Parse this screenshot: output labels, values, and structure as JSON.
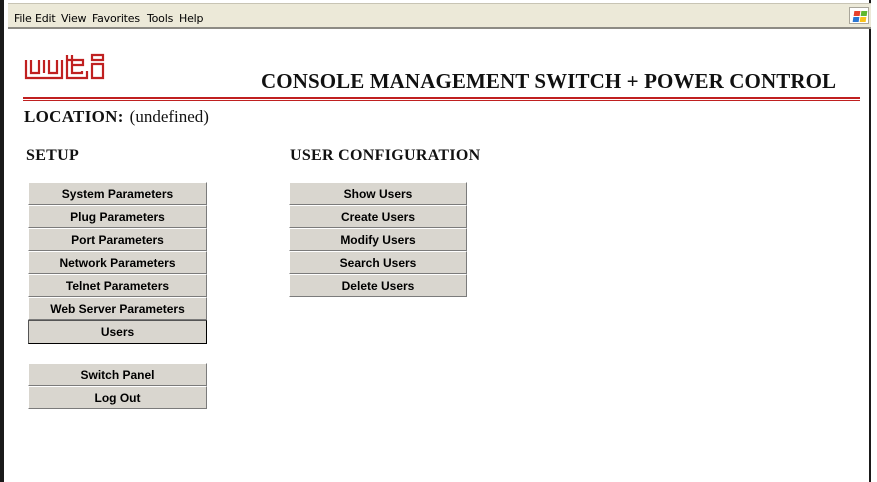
{
  "browser": {
    "menu": [
      "File",
      "Edit",
      "View",
      "Favorites",
      "Tools",
      "Help"
    ],
    "logo_icon": "windows-flag-icon"
  },
  "header": {
    "logo_text": "wti",
    "title": "CONSOLE MANAGEMENT SWITCH + POWER CONTROL",
    "accent_color": "#c02020"
  },
  "location": {
    "label": "LOCATION:",
    "value": "(undefined)"
  },
  "setup": {
    "heading": "SETUP",
    "items": [
      {
        "label": "System Parameters",
        "selected": false
      },
      {
        "label": "Plug Parameters",
        "selected": false
      },
      {
        "label": "Port Parameters",
        "selected": false
      },
      {
        "label": "Network Parameters",
        "selected": false
      },
      {
        "label": "Telnet Parameters",
        "selected": false
      },
      {
        "label": "Web Server Parameters",
        "selected": false
      },
      {
        "label": "Users",
        "selected": true
      }
    ],
    "panel_items": [
      "Switch Panel",
      "Log Out"
    ]
  },
  "user_configuration": {
    "heading": "USER CONFIGURATION",
    "items": [
      "Show Users",
      "Create Users",
      "Modify Users",
      "Search Users",
      "Delete Users"
    ]
  }
}
